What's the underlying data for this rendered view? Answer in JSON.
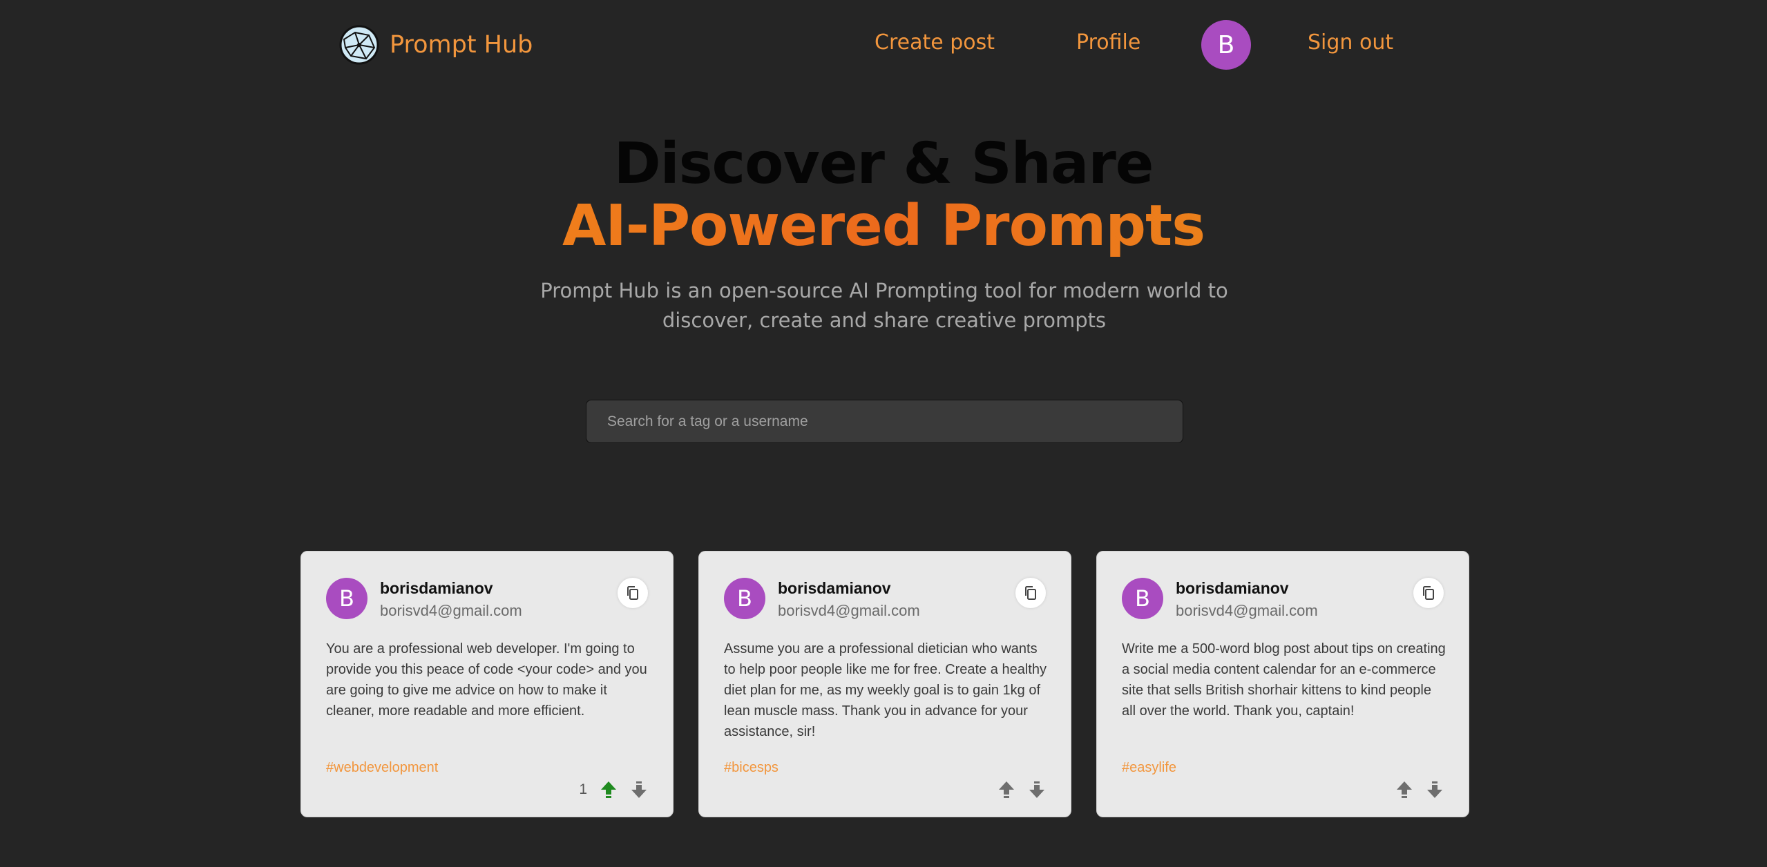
{
  "nav": {
    "brand": "Prompt Hub",
    "create_post": "Create post",
    "profile": "Profile",
    "avatar_initial": "B",
    "sign_out": "Sign out"
  },
  "hero": {
    "title_line1": "Discover & Share",
    "title_line2": "AI-Powered Prompts",
    "description": "Prompt Hub is an open-source AI Prompting tool for modern world to discover, create and share creative prompts"
  },
  "search": {
    "placeholder": "Search for a tag or a username",
    "value": ""
  },
  "posts": [
    {
      "avatar_initial": "B",
      "username": "borisdamianov",
      "email": "borisvd4@gmail.com",
      "text": "You are a professional web developer. I'm going to provide you this peace of code <your code> and you are going to give me advice on how to make it cleaner, more readable and more efficient.",
      "tag": "#webdevelopment",
      "vote_count": "1",
      "upvoted": true
    },
    {
      "avatar_initial": "B",
      "username": "borisdamianov",
      "email": "borisvd4@gmail.com",
      "text": "Assume you are a professional dietician who wants to help poor people like me for free. Create a healthy diet plan for me, as my weekly goal is to gain 1kg of lean muscle mass. Thank you in advance for your assistance, sir!",
      "tag": "#bicesps",
      "vote_count": "",
      "upvoted": false
    },
    {
      "avatar_initial": "B",
      "username": "borisdamianov",
      "email": "borisvd4@gmail.com",
      "text": "Write me a 500-word blog post about tips on creating a social media content calendar for an e-commerce site that sells British shorhair kittens to kind people all over the world. Thank you, captain!",
      "tag": "#easylife",
      "vote_count": "",
      "upvoted": false
    }
  ],
  "colors": {
    "background": "#252525",
    "accent": "#f2963d",
    "avatar": "#a94cc0",
    "card": "#e9e9e9",
    "upvote_active": "#1f8a1f",
    "vote_inactive": "#6e6e6e"
  },
  "icons": {
    "logo": "globe-network-icon",
    "copy": "copy-icon",
    "upvote": "arrow-up-icon",
    "downvote": "arrow-down-icon"
  }
}
